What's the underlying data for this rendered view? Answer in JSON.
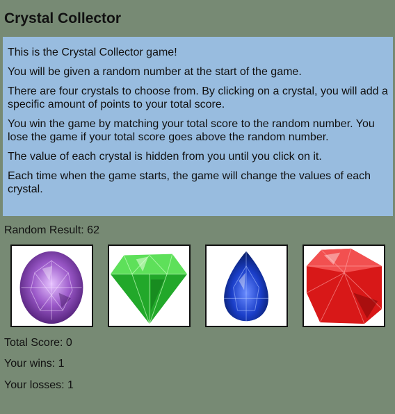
{
  "title": "Crystal Collector",
  "instructions": [
    "This is the Crystal Collector game!",
    "You will be given a random number at the start of the game.",
    "There are four crystals to choose from. By clicking on a crystal, you will add a specific amount of points to your total score.",
    "You win the game by matching your total score to the random number. You lose the game if your total score goes above the random number.",
    "The value of each crystal is hidden from you until you click on it.",
    "Each time when the game starts, the game will change the values of each crystal."
  ],
  "random_result": "Random Result: 62",
  "crystals": [
    {
      "icon": "amethyst-crystal-icon",
      "color": "#9a58c8"
    },
    {
      "icon": "emerald-crystal-icon",
      "color": "#2fb82a"
    },
    {
      "icon": "sapphire-crystal-icon",
      "color": "#1a3ec8"
    },
    {
      "icon": "ruby-crystal-icon",
      "color": "#d81818"
    }
  ],
  "total_score": "Total Score: 0",
  "wins": "Your wins: 1",
  "losses": "Your losses: 1"
}
